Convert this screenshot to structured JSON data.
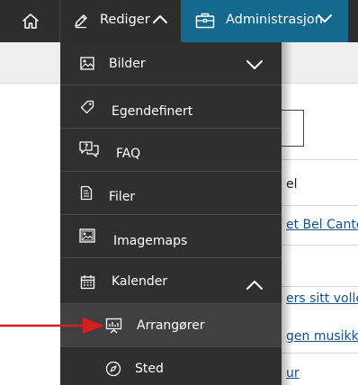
{
  "topbar": {
    "home_icon": "home-icon",
    "edit_label": "Rediger",
    "edit_icon": "pencil-icon",
    "admin_label": "Administrasjon",
    "admin_icon": "briefcase-icon",
    "admin_color": "#14698f"
  },
  "menu": {
    "items": [
      {
        "label": "Bilder",
        "icon": "image-icon"
      },
      {
        "label": "Egendefinert",
        "icon": "tag-icon"
      },
      {
        "label": "FAQ",
        "icon": "chat-bubbles-icon"
      },
      {
        "label": "Filer",
        "icon": "file-icon"
      },
      {
        "label": "Imagemaps",
        "icon": "image-icon"
      },
      {
        "label": "Kalender",
        "icon": "calendar-icon"
      },
      {
        "label": "Arrangører",
        "icon": "presentation-icon"
      },
      {
        "label": "Sted",
        "icon": "compass-icon"
      }
    ]
  },
  "background": {
    "row1": "el",
    "row2": "et Bel Canto",
    "row3": "ers sitt volle",
    "row4": "gen musikks",
    "row5": "ur"
  },
  "annotation": {
    "arrow_color": "#d42020"
  }
}
